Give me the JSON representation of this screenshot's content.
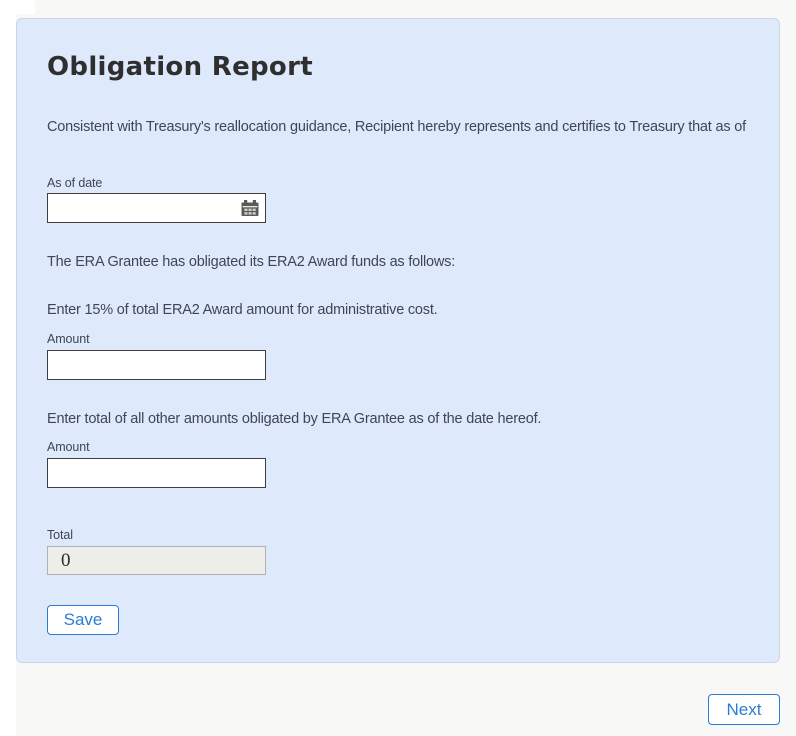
{
  "title": "Obligation Report",
  "intro": "Consistent with Treasury's reallocation guidance, Recipient hereby represents and certifies to Treasury that as of",
  "as_of_date": {
    "label": "As of date",
    "value": ""
  },
  "funds_text": "The ERA Grantee has obligated its ERA2 Award funds as follows:",
  "admin": {
    "instruction": "Enter 15% of total ERA2 Award amount for administrative cost.",
    "label": "Amount",
    "value": ""
  },
  "other": {
    "instruction": "Enter total of all other amounts obligated by ERA Grantee as of the date hereof.",
    "label": "Amount",
    "value": ""
  },
  "total": {
    "label": "Total",
    "value": "0"
  },
  "buttons": {
    "save": "Save",
    "next": "Next"
  },
  "icons": {
    "calendar": "calendar-icon"
  },
  "colors": {
    "accent_blue": "#2b7cd3",
    "panel_bg": "#dee9fb",
    "page_bg": "#f8f8f6",
    "text": "#3e4753",
    "input_border": "#3f3f3f",
    "disabled_bg": "#ededea",
    "disabled_border": "#b1b1b1",
    "icon_gray": "#5a5a5a"
  }
}
